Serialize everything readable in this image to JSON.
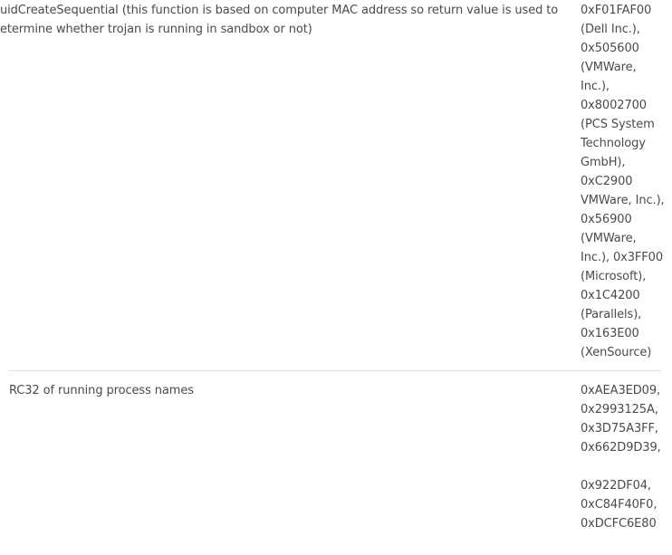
{
  "table": {
    "rows": [
      {
        "description_lines": [
          "uidCreateSequential (this function is based on computer MAC address so return value is used to",
          "etermine whether trojan is running in sandbox or not)"
        ],
        "value_lines": [
          "0xF01FAF00",
          "(Dell Inc.),",
          "0x505600",
          "(VMWare,",
          "Inc.),",
          "0x8002700",
          "(PCS System",
          "Technology",
          "GmbH),",
          "0xC2900",
          "VMWare, Inc.),",
          "0x56900",
          "(VMWare,",
          "Inc.), 0x3FF00",
          "(Microsoft),",
          "0x1C4200",
          "(Parallels),",
          "0x163E00",
          "(XenSource)"
        ]
      },
      {
        "description_lines": [
          "RC32 of running process names"
        ],
        "value_lines": [
          "0xAEA3ED09,",
          "0x2993125A,",
          "0x3D75A3FF,",
          "0x662D9D39,",
          "0x922DF04,",
          "0xC84F40F0,",
          "0xDCFC6E80"
        ]
      }
    ]
  }
}
